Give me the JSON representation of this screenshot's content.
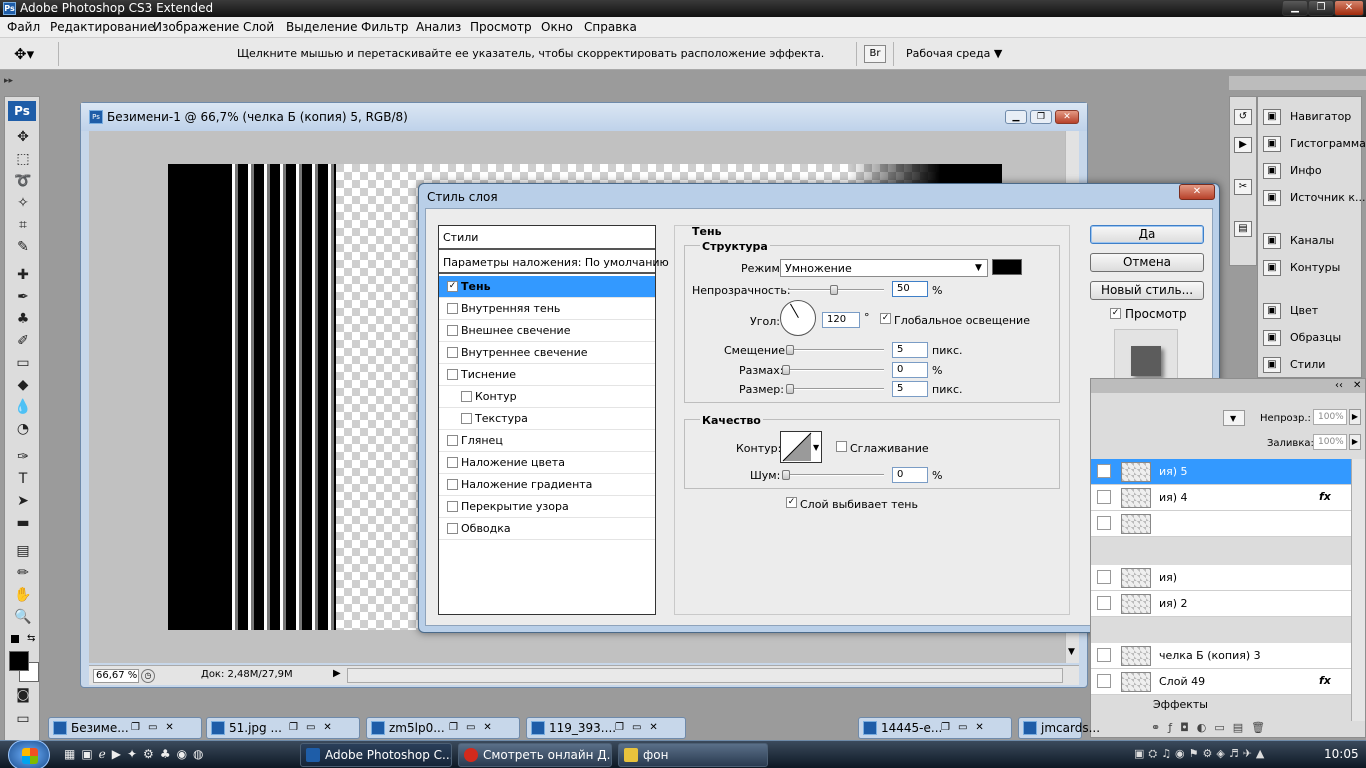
{
  "app": {
    "title": "Adobe Photoshop CS3 Extended",
    "ps_label": "Ps"
  },
  "menu": [
    "Файл",
    "Редактирование",
    "Изображение",
    "Слой",
    "Выделение",
    "Фильтр",
    "Анализ",
    "Просмотр",
    "Окно",
    "Справка"
  ],
  "options_bar": {
    "hint": "Щелкните мышью и перетаскивайте ее указатель, чтобы скорректировать расположение эффекта.",
    "workspace": "Рабочая среда"
  },
  "document": {
    "title": "Безимени-1 @ 66,7% (челка Б (копия) 5, RGB/8)",
    "zoom": "66,67 %",
    "doc_info": "Док: 2,48M/27,9M"
  },
  "dialog": {
    "title": "Стиль слоя",
    "styles_header": "Стили",
    "blending_options": "Параметры наложения: По умолчанию",
    "styles": [
      {
        "label": "Тень",
        "checked": true,
        "selected": true,
        "indent": false
      },
      {
        "label": "Внутренняя тень",
        "checked": false,
        "selected": false,
        "indent": false
      },
      {
        "label": "Внешнее свечение",
        "checked": false,
        "selected": false,
        "indent": false
      },
      {
        "label": "Внутреннее свечение",
        "checked": false,
        "selected": false,
        "indent": false
      },
      {
        "label": "Тиснение",
        "checked": false,
        "selected": false,
        "indent": false
      },
      {
        "label": "Контур",
        "checked": false,
        "selected": false,
        "indent": true
      },
      {
        "label": "Текстура",
        "checked": false,
        "selected": false,
        "indent": true
      },
      {
        "label": "Глянец",
        "checked": false,
        "selected": false,
        "indent": false
      },
      {
        "label": "Наложение цвета",
        "checked": false,
        "selected": false,
        "indent": false
      },
      {
        "label": "Наложение градиента",
        "checked": false,
        "selected": false,
        "indent": false
      },
      {
        "label": "Перекрытие узора",
        "checked": false,
        "selected": false,
        "indent": false
      },
      {
        "label": "Обводка",
        "checked": false,
        "selected": false,
        "indent": false
      }
    ],
    "section_title": "Тень",
    "structure": {
      "title": "Структура",
      "mode_label": "Режим:",
      "mode_value": "Умножение",
      "shadow_color": "#000000",
      "opacity_label": "Непрозрачность:",
      "opacity_value": "50",
      "opacity_unit": "%",
      "angle_label": "Угол:",
      "angle_value": "120",
      "angle_unit": "°",
      "global_light_label": "Глобальное освещение",
      "global_light_checked": true,
      "distance_label": "Смещение:",
      "distance_value": "5",
      "distance_unit": "пикс.",
      "spread_label": "Размах:",
      "spread_value": "0",
      "spread_unit": "%",
      "size_label": "Размер:",
      "size_value": "5",
      "size_unit": "пикс."
    },
    "quality": {
      "title": "Качество",
      "contour_label": "Контур:",
      "antialias_label": "Сглаживание",
      "antialias_checked": false,
      "noise_label": "Шум:",
      "noise_value": "0",
      "noise_unit": "%"
    },
    "knockout_label": "Слой выбивает тень",
    "knockout_checked": true,
    "buttons": {
      "ok": "Да",
      "cancel": "Отмена",
      "new_style": "Новый стиль..."
    },
    "preview_label": "Просмотр",
    "preview_checked": true
  },
  "panels": [
    {
      "label": "Навигатор",
      "icon": "navigator-icon"
    },
    {
      "label": "Гистограмма",
      "icon": "histogram-icon"
    },
    {
      "label": "Инфо",
      "icon": "info-icon"
    },
    {
      "label": "Источник к...",
      "icon": "clone-source-icon"
    },
    {
      "label": "Каналы",
      "icon": "channels-icon"
    },
    {
      "label": "Контуры",
      "icon": "paths-icon"
    },
    {
      "label": "Цвет",
      "icon": "color-icon"
    },
    {
      "label": "Образцы",
      "icon": "swatches-icon"
    },
    {
      "label": "Стили",
      "icon": "styles-icon"
    }
  ],
  "layers_panel": {
    "opacity_label": "Непрозр.:",
    "opacity_value": "100%",
    "fill_label": "Заливка:",
    "fill_value": "100%",
    "rows": [
      {
        "name": "ия) 5",
        "fx": false,
        "selected": true
      },
      {
        "name": "ия) 4",
        "fx": true,
        "selected": false
      },
      {
        "name": "",
        "fx": false,
        "selected": false
      },
      {
        "name": "ия)",
        "fx": false,
        "selected": false
      },
      {
        "name": "ия) 2",
        "fx": false,
        "selected": false
      },
      {
        "name": "челка Б (копия) 3",
        "fx": false,
        "selected": false
      },
      {
        "name": "Слой 49",
        "fx": true,
        "selected": false
      }
    ],
    "effects_label": "Эффекты"
  },
  "minimized_docs": [
    "Безиме...",
    "51.jpg ...",
    "zm5lp0...",
    "119_393....",
    "14445-e...",
    "jmcards..."
  ],
  "taskbar": {
    "items": [
      "Adobe Photoshop C...",
      "Смотреть онлайн Д...",
      "фон"
    ],
    "clock": "10:05"
  }
}
